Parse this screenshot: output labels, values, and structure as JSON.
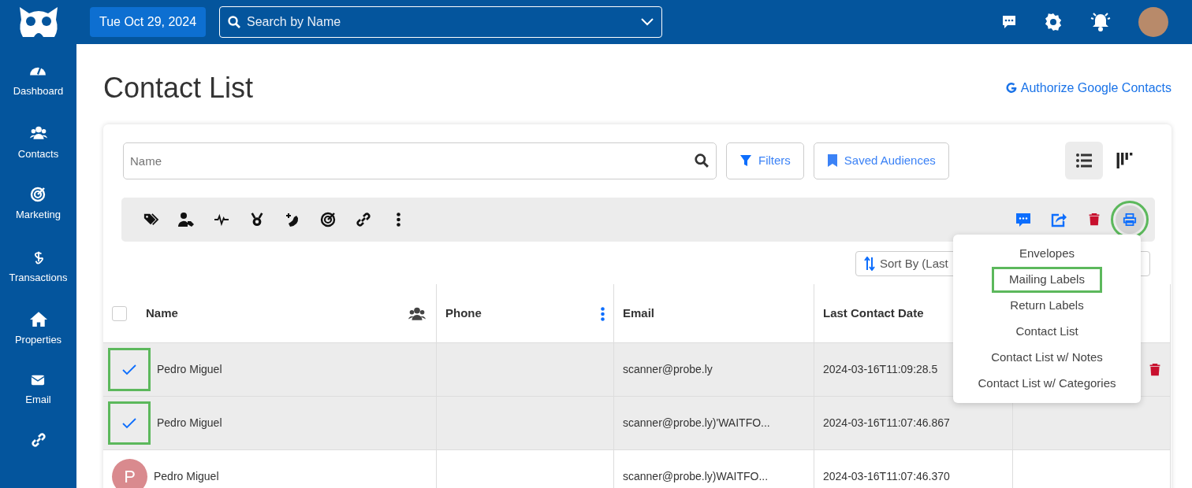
{
  "header": {
    "date": "Tue Oct 29, 2024",
    "search_placeholder": "Search by Name"
  },
  "sidebar": {
    "items": [
      {
        "kind": "gauge",
        "label": "Dashboard"
      },
      {
        "kind": "users",
        "label": "Contacts"
      },
      {
        "kind": "target",
        "label": "Marketing"
      },
      {
        "kind": "dollar",
        "label": "Transactions"
      },
      {
        "kind": "house",
        "label": "Properties"
      },
      {
        "kind": "envelope",
        "label": "Email"
      },
      {
        "kind": "link"
      }
    ]
  },
  "page": {
    "title": "Contact List",
    "google_link": "Authorize Google Contacts"
  },
  "filters": {
    "name_placeholder": "Name",
    "filters_button": "Filters",
    "audiences_button": "Saved Audiences",
    "views": [
      {
        "kind": "list",
        "selected": true
      },
      {
        "kind": "board",
        "selected": false
      }
    ]
  },
  "toolbar": {
    "left": [
      {
        "kind": "tags"
      },
      {
        "kind": "user-tag"
      },
      {
        "kind": "pulse"
      },
      {
        "kind": "medal"
      },
      {
        "kind": "phone-plus"
      },
      {
        "kind": "target"
      },
      {
        "kind": "link"
      },
      {
        "kind": "kebab"
      }
    ],
    "right": [
      {
        "kind": "comment",
        "highlighted": false
      },
      {
        "kind": "share",
        "highlighted": false
      },
      {
        "kind": "trash",
        "highlighted": false
      },
      {
        "kind": "print",
        "highlighted": true
      }
    ]
  },
  "sort_label": "Sort By (Last",
  "table": {
    "all_checked": false,
    "columns": [
      "Name",
      "Phone",
      "Email",
      "Last Contact Date"
    ],
    "rows": [
      {
        "checked": true,
        "highlighted": true,
        "name": "Pedro Miguel",
        "email": "scanner@probe.ly",
        "last_contact": "2024-03-16T11:09:28.5",
        "delete": true
      },
      {
        "checked": true,
        "highlighted": true,
        "name": "Pedro Miguel",
        "email": "scanner@probe.ly)'WAITFO...",
        "last_contact": "2024-03-16T11:07:46.867",
        "delete": false
      },
      {
        "checked": false,
        "highlighted": false,
        "avatar": "P",
        "name": "Pedro Miguel",
        "email": "scanner@probe.ly)WAITFO...",
        "last_contact": "2024-03-16T11:07:46.370",
        "delete": false
      }
    ]
  },
  "print_menu": {
    "items": [
      {
        "label": "Envelopes",
        "highlighted": false
      },
      {
        "label": "Mailing Labels",
        "highlighted": true
      },
      {
        "label": "Return Labels",
        "highlighted": false
      },
      {
        "label": "Contact List",
        "highlighted": false
      },
      {
        "label": "Contact List w/ Notes",
        "highlighted": false
      },
      {
        "label": "Contact List w/ Categories",
        "highlighted": false
      }
    ]
  }
}
